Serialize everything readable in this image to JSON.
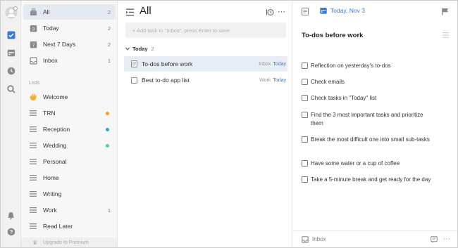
{
  "sidebar": {
    "smart_lists": [
      {
        "label": "All",
        "count": "2"
      },
      {
        "label": "Today",
        "count": "2"
      },
      {
        "label": "Next 7 Days",
        "count": "2"
      },
      {
        "label": "Inbox",
        "count": "1"
      }
    ],
    "section_label": "Lists",
    "lists": [
      {
        "label": "Welcome",
        "count": "",
        "icon": "waving-hand-icon"
      },
      {
        "label": "TRN",
        "count": "",
        "dot": "#f0a02c"
      },
      {
        "label": "Reception",
        "count": "",
        "dot": "#2aa8c4"
      },
      {
        "label": "Wedding",
        "count": "",
        "dot": "#4cd0b0"
      },
      {
        "label": "Personal",
        "count": ""
      },
      {
        "label": "Home",
        "count": ""
      },
      {
        "label": "Writing",
        "count": ""
      },
      {
        "label": "Work",
        "count": "1"
      },
      {
        "label": "Read Later",
        "count": ""
      }
    ],
    "premium_label": "Upgrade to Premium"
  },
  "middle": {
    "title": "All",
    "add_placeholder": "+ Add task to \"Inbox\", press Enter to save.",
    "group": {
      "label": "Today",
      "count": "2"
    },
    "tasks": [
      {
        "title": "To-dos before work",
        "tag": "Inbox",
        "date": "Today"
      },
      {
        "title": "Best to-do app list",
        "tag": "Work",
        "date": "Today"
      }
    ]
  },
  "detail": {
    "date": "Today, Nov 3",
    "title": "To-dos before work",
    "checklist": [
      "Reflection on yesterday's to-dos",
      "Check emails",
      "Check tasks in \"Today\" list",
      "Find the 3 most important tasks and prioritize them",
      "Break the most difficult one into small sub-tasks",
      "Have some water or a cup of coffee",
      "Take a 5-minute break and get ready for the day"
    ],
    "footer_list": "Inbox"
  },
  "colors": {
    "accent": "#3a78d8",
    "selected": "#e7ecf5",
    "sidebar_active": "#e4e8ef"
  }
}
